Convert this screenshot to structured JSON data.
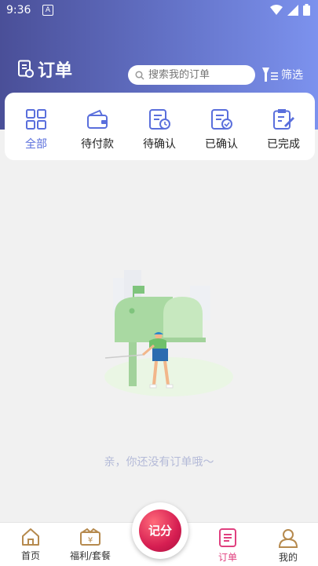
{
  "status": {
    "time": "9:36",
    "notification_badge": "A"
  },
  "header": {
    "title": "订单",
    "search_placeholder": "搜索我的订单",
    "filter_label": "筛选"
  },
  "tabs": [
    {
      "label": "全部",
      "icon": "grid-icon",
      "active": true
    },
    {
      "label": "待付款",
      "icon": "wallet-icon",
      "active": false
    },
    {
      "label": "待确认",
      "icon": "pending-clock-icon",
      "active": false
    },
    {
      "label": "已确认",
      "icon": "confirmed-check-icon",
      "active": false
    },
    {
      "label": "已完成",
      "icon": "completed-edit-icon",
      "active": false
    }
  ],
  "empty_state": {
    "message": "亲，你还没有订单哦～"
  },
  "bottom_nav": {
    "items": [
      {
        "label": "首页",
        "icon": "home-icon",
        "active": false
      },
      {
        "label": "福利/套餐",
        "icon": "gift-box-icon",
        "active": false
      },
      {
        "label": "订单",
        "icon": "order-list-icon",
        "active": true
      },
      {
        "label": "我的",
        "icon": "profile-icon",
        "active": false
      }
    ],
    "center_button": "记分"
  },
  "colors": {
    "accent": "#5a6fdc",
    "active_nav": "#e0407f",
    "header_gradient_start": "#4a4f98",
    "header_gradient_end": "#7c92ee"
  }
}
